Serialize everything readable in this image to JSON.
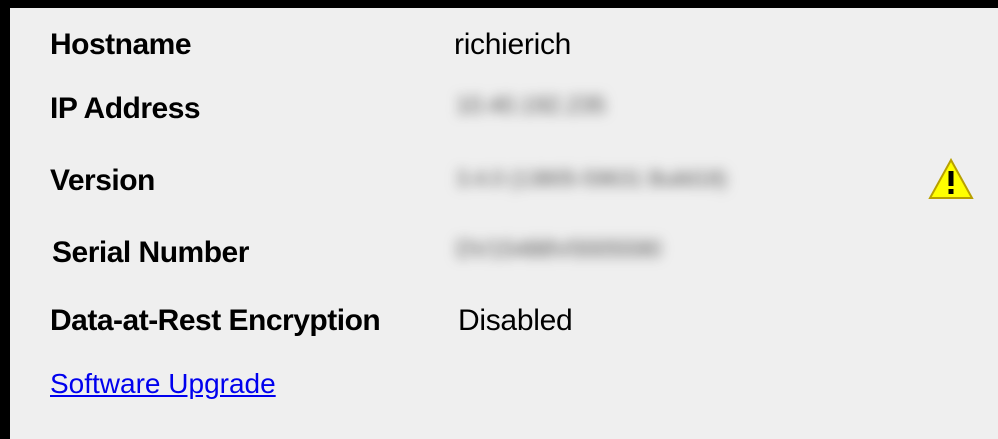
{
  "info": {
    "hostname_label": "Hostname",
    "hostname_value": "richierich",
    "ip_label": "IP Address",
    "ip_value": "10.40.192.235",
    "version_label": "Version",
    "version_value": "3.4.0 (13805-59631 Build18)",
    "version_warning_icon": "warning-triangle-icon",
    "serial_label": "Serial Number",
    "serial_value": "DV15488V0005590",
    "encryption_label": "Data-at-Rest Encryption",
    "encryption_value": "Disabled"
  },
  "links": {
    "software_upgrade": "Software Upgrade"
  },
  "colors": {
    "panel_bg": "#efefef",
    "link": "#0000ee",
    "warning_fill": "#ffff00",
    "border": "#000000"
  }
}
